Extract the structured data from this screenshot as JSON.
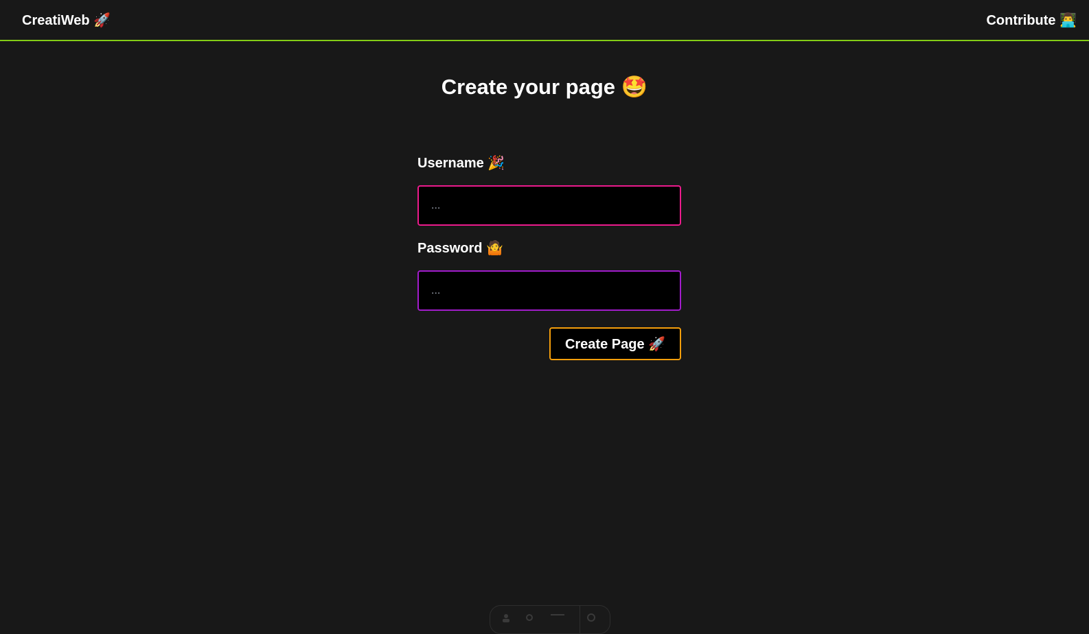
{
  "header": {
    "brand": "CreatiWeb 🚀",
    "contribute": "Contribute 👨‍💻"
  },
  "main": {
    "title": "Create your page 🤩"
  },
  "form": {
    "username_label": "Username 🎉",
    "username_placeholder": "...",
    "username_value": "",
    "password_label": "Password 🤷",
    "password_placeholder": "...",
    "password_value": "",
    "submit_label": "Create Page  🚀"
  },
  "colors": {
    "background": "#181818",
    "header_border": "#84cc16",
    "username_border": "#ec1b8c",
    "password_border": "#a21ccc",
    "button_border": "#f59e0b"
  },
  "dock": {
    "icons": [
      "user-icon",
      "settings-icon",
      "menu-icon",
      "gear-icon"
    ]
  }
}
